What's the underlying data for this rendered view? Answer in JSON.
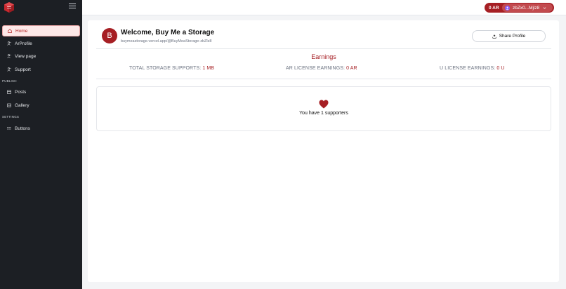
{
  "sidebar": {
    "items": [
      {
        "label": "Home",
        "icon": "home-icon",
        "active": true
      },
      {
        "label": "ArProfile",
        "icon": "user-icon"
      },
      {
        "label": "View page",
        "icon": "user-icon"
      },
      {
        "label": "Support",
        "icon": "user-icon"
      }
    ],
    "publish_label": "PUBLISH",
    "publish_items": [
      {
        "label": "Posts",
        "icon": "calendar-icon"
      },
      {
        "label": "Gallery",
        "icon": "image-icon"
      }
    ],
    "settings_label": "SETTINGS",
    "settings_items": [
      {
        "label": "Buttons",
        "icon": "list-icon"
      }
    ]
  },
  "topbar": {
    "balance": "0 AR",
    "address": "zbZx0...Mjlz8"
  },
  "profile": {
    "avatar_letter": "B",
    "welcome": "Welcome, Buy Me a Storage",
    "url": "buymeastorage.vercel.app/@BuyMeaStorage-zbZlz8",
    "share_label": "Share Profile"
  },
  "earnings": {
    "title": "Earnings",
    "storage_label": "TOTAL STORAGE SUPPORTS:",
    "storage_value": "1 MB",
    "ar_label": "AR LICENSE EARNINGS:",
    "ar_value": "0 AR",
    "u_label": "U LICENSE EARNINGS:",
    "u_value": "0 U"
  },
  "supporters": {
    "text": "You have 1 supporters"
  },
  "colors": {
    "accent": "#a61f24",
    "sidebar_bg": "#1c1f24",
    "active_bg": "#fde8e8"
  }
}
